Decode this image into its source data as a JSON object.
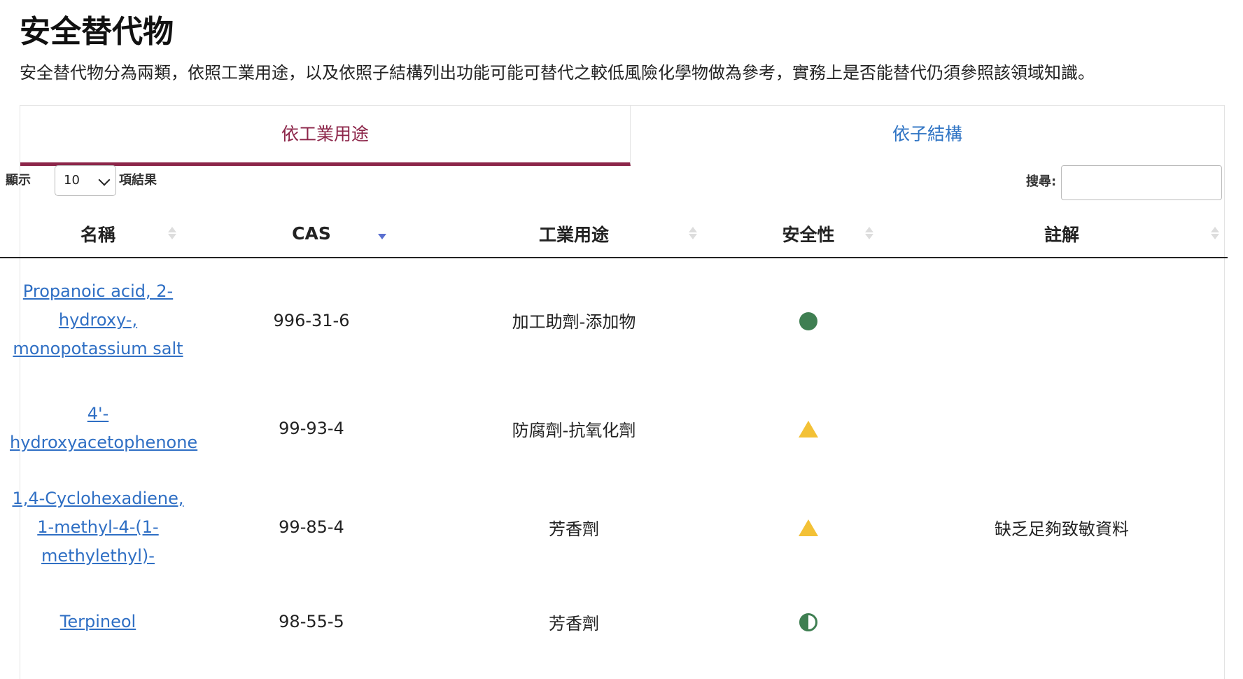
{
  "page": {
    "title": "安全替代物",
    "description": "安全替代物分為兩類，依照工業用途，以及依照子結構列出功能可能可替代之較低風險化學物做為參考，實務上是否能替代仍須參照該領域知識。"
  },
  "tabs": [
    {
      "label": "依工業用途",
      "active": true
    },
    {
      "label": "依子結構",
      "active": false
    }
  ],
  "controls": {
    "length_prefix": "顯示",
    "length_value": "10",
    "length_suffix": "項結果",
    "search_label": "搜尋:",
    "search_value": ""
  },
  "table": {
    "columns": [
      "名稱",
      "CAS",
      "工業用途",
      "安全性",
      "註解"
    ],
    "sorted_column": "CAS",
    "sort_direction": "descending",
    "rows": [
      {
        "name": "Propanoic acid, 2-hydroxy-, monopotassium salt",
        "cas": "996-31-6",
        "use": "加工助劑-添加物",
        "safety": "green-circle",
        "note": ""
      },
      {
        "name": "4'-hydroxyacetophenone",
        "cas": "99-93-4",
        "use": "防腐劑-抗氧化劑",
        "safety": "yellow-triangle",
        "note": ""
      },
      {
        "name": "1,4-Cyclohexadiene, 1-methyl-4-(1-methylethyl)-",
        "cas": "99-85-4",
        "use": "芳香劑",
        "safety": "yellow-triangle",
        "note": "缺乏足夠致敏資料"
      },
      {
        "name": "Terpineol",
        "cas": "98-55-5",
        "use": "芳香劑",
        "safety": "half-green-circle",
        "note": ""
      }
    ]
  },
  "colors": {
    "accent": "#8c2549",
    "link": "#2f6fc4",
    "safe_green": "#3f7f52",
    "caution_yellow": "#f3c136"
  }
}
